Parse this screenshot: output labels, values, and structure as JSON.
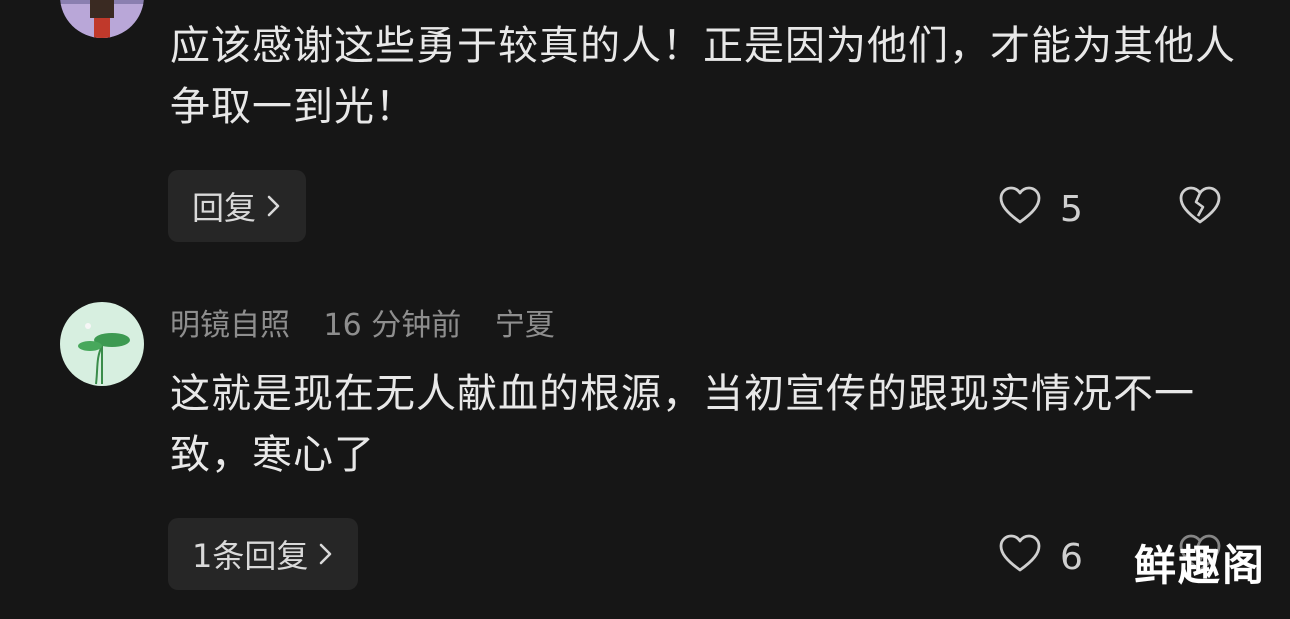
{
  "comments": [
    {
      "text": "应该感谢这些勇于较真的人！正是因为他们，才能为其他人争取一到光！",
      "reply_label": "回复",
      "likes": "5"
    },
    {
      "username": "明镜自照",
      "time": "16 分钟前",
      "location": "宁夏",
      "text": "这就是现在无人献血的根源，当初宣传的跟现实情况不一致，寒心了",
      "reply_label": "1条回复",
      "likes": "6"
    }
  ],
  "watermark": "鲜趣阁",
  "colors": {
    "background": "#161616",
    "text": "#e8e8e8",
    "meta": "#8e8e8e",
    "button_bg": "#262626"
  },
  "icons": [
    "heart-icon",
    "broken-heart-icon",
    "chevron-right-icon"
  ]
}
